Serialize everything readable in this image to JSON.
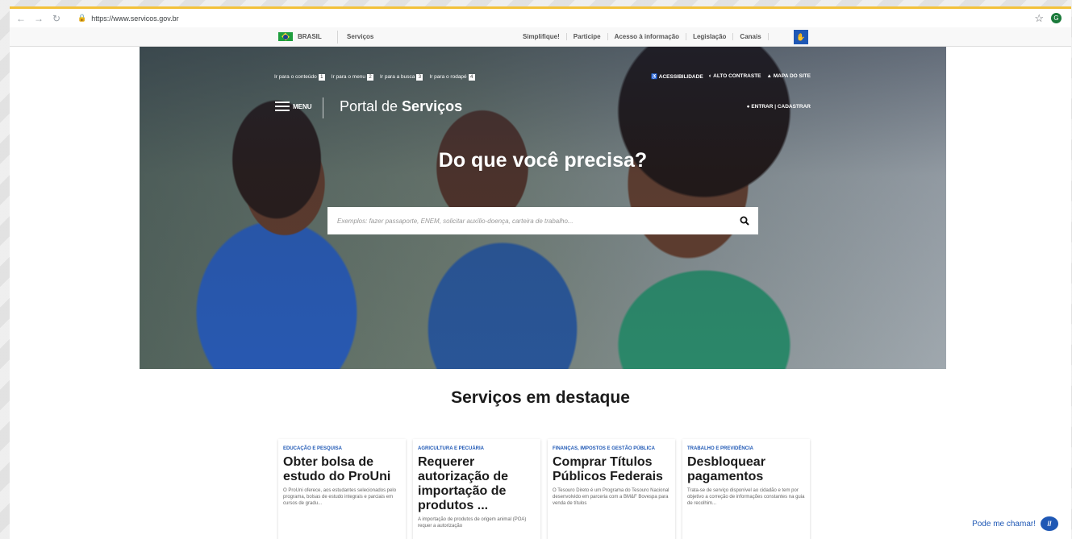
{
  "browser": {
    "url": "https://www.servicos.gov.br",
    "back_icon": "arrow-left",
    "forward_icon": "arrow-right",
    "reload_icon": "reload",
    "profile_initial": "G"
  },
  "govbar": {
    "country_label": "BRASIL",
    "services_label": "Serviços",
    "links": [
      "Simplifique!",
      "Participe",
      "Acesso à informação",
      "Legislação",
      "Canais"
    ]
  },
  "hero": {
    "skip_links": [
      {
        "label": "Ir para o conteúdo",
        "key": "1"
      },
      {
        "label": "Ir para o menu",
        "key": "2"
      },
      {
        "label": "Ir para a busca",
        "key": "3"
      },
      {
        "label": "Ir para o rodapé",
        "key": "4"
      }
    ],
    "accessibility_links": [
      "ACESSIBILIDADE",
      "ALTO CONTRASTE",
      "MAPA DO SITE"
    ],
    "menu_label": "MENU",
    "portal_prefix": "Portal de ",
    "portal_bold": "Serviços",
    "login_label": "ENTRAR | CADASTRAR",
    "headline": "Do que você precisa?",
    "search_placeholder": "Exemplos: fazer passaporte, ENEM, solicitar auxílio-doença, carteira de trabalho..."
  },
  "featured": {
    "title": "Serviços em destaque",
    "cards": [
      {
        "category": "EDUCAÇÃO E PESQUISA",
        "title": "Obter bolsa de estudo do ProUni",
        "description": "O ProUni oferece, aos estudantes selecionados pelo programa, bolsas de estudo integrais e parciais em cursos de gradu..."
      },
      {
        "category": "AGRICULTURA E PECUÁRIA",
        "title": "Requerer autorização de importação de produtos ...",
        "description": "A importação de produtos de origem animal (POA) requer a autorização"
      },
      {
        "category": "FINANÇAS, IMPOSTOS E GESTÃO PÚBLICA",
        "title": "Comprar Títulos Públicos Federais",
        "description": "O Tesouro Direto é um Programa do Tesouro Nacional desenvolvido em parceria com a BM&F Bovespa para venda de títulos"
      },
      {
        "category": "TRABALHO E PREVIDÊNCIA",
        "title": "Desbloquear pagamentos",
        "description": "Trata-se de serviço disponível ao cidadão e tem por objetivo a correção de informações constantes na guia de recolhim..."
      }
    ]
  },
  "chat": {
    "label": "Pode me chamar!"
  }
}
